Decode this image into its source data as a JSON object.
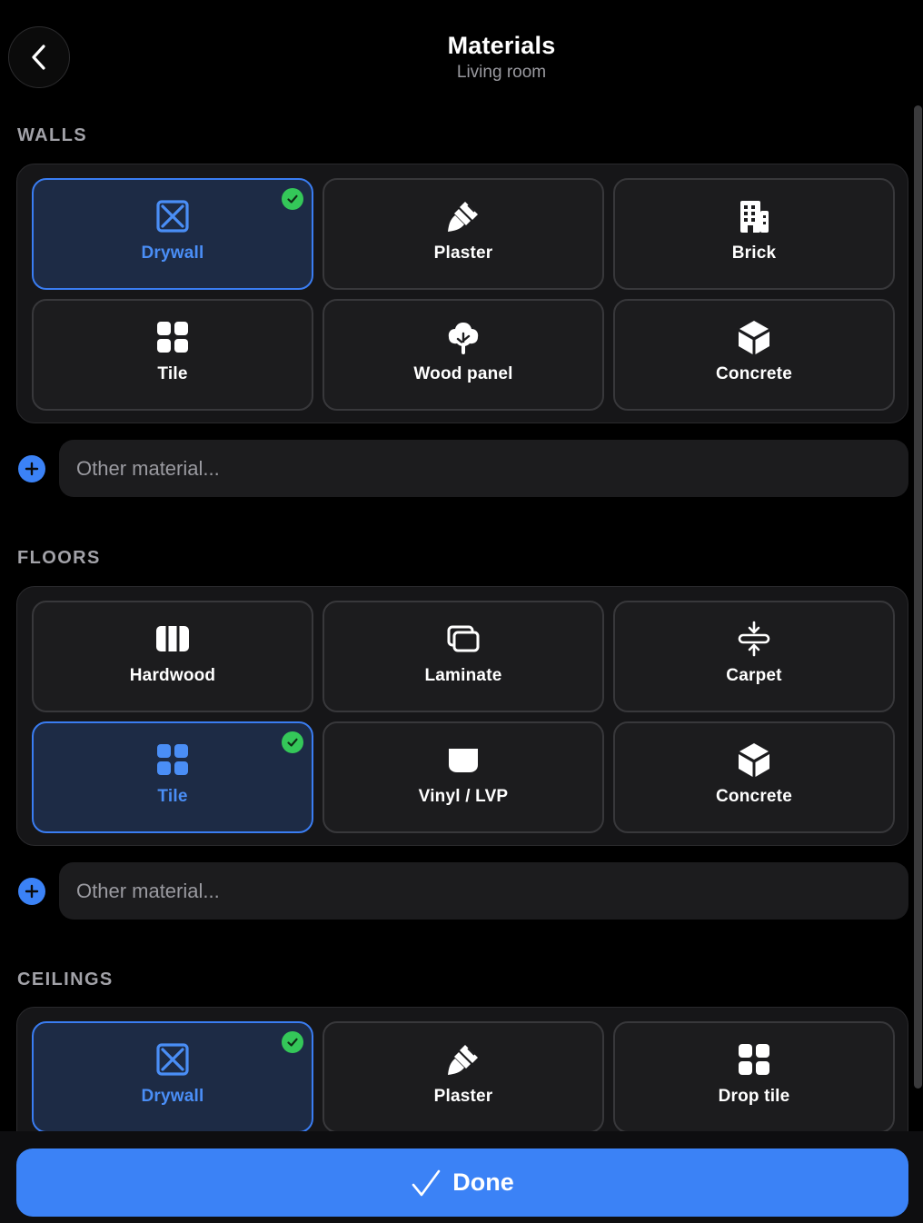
{
  "header": {
    "title": "Materials",
    "subtitle": "Living room",
    "back_icon": "chevron-left-icon"
  },
  "colors": {
    "accent": "#3b82f6",
    "selected_bg": "#1d2b45",
    "selected_border": "#3a7df2",
    "check": "#34c759"
  },
  "walls": {
    "label": "WALLS",
    "other_placeholder": "Other material...",
    "items": [
      {
        "label": "Drywall",
        "icon": "drywall-icon",
        "selected": true
      },
      {
        "label": "Plaster",
        "icon": "paintbrush-icon",
        "selected": false
      },
      {
        "label": "Brick",
        "icon": "building-icon",
        "selected": false
      },
      {
        "label": "Tile",
        "icon": "grid-icon",
        "selected": false
      },
      {
        "label": "Wood panel",
        "icon": "tree-icon",
        "selected": false
      },
      {
        "label": "Concrete",
        "icon": "cube-icon",
        "selected": false
      }
    ]
  },
  "floors": {
    "label": "FLOORS",
    "other_placeholder": "Other material...",
    "items": [
      {
        "label": "Hardwood",
        "icon": "planks-icon",
        "selected": false
      },
      {
        "label": "Laminate",
        "icon": "layers-icon",
        "selected": false
      },
      {
        "label": "Carpet",
        "icon": "compress-icon",
        "selected": false
      },
      {
        "label": "Tile",
        "icon": "grid-icon",
        "selected": true
      },
      {
        "label": "Vinyl / LVP",
        "icon": "rounded-rect-icon",
        "selected": false
      },
      {
        "label": "Concrete",
        "icon": "cube-icon",
        "selected": false
      }
    ]
  },
  "ceilings": {
    "label": "CEILINGS",
    "items": [
      {
        "label": "Drywall",
        "icon": "drywall-icon",
        "selected": true
      },
      {
        "label": "Plaster",
        "icon": "paintbrush-icon",
        "selected": false
      },
      {
        "label": "Drop tile",
        "icon": "grid-icon",
        "selected": false
      }
    ]
  },
  "footer": {
    "done_label": "Done",
    "done_icon": "checkmark-icon"
  }
}
